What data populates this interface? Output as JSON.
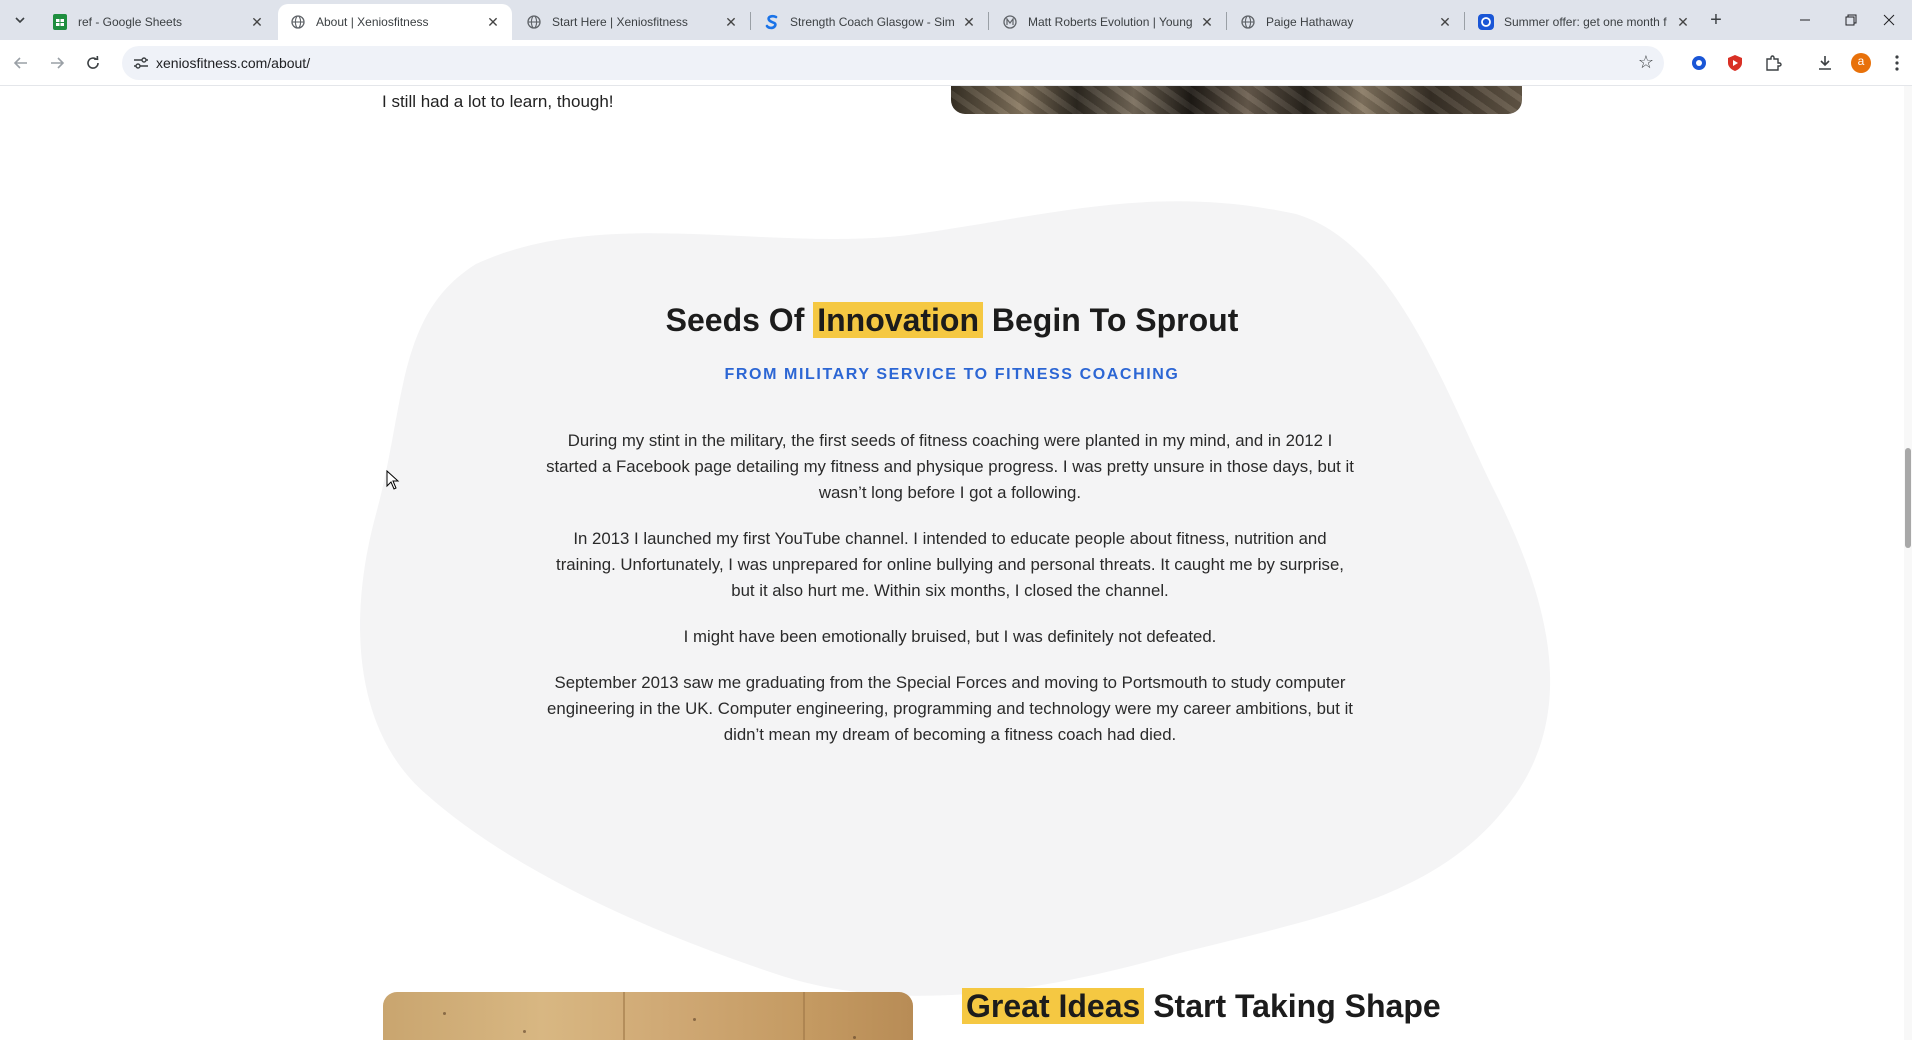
{
  "browser": {
    "tabs": [
      {
        "title": "ref - Google Sheets",
        "active": false,
        "favicon": "sheets-icon",
        "color": "#1e8e3e"
      },
      {
        "title": "About | Xeniosfitness",
        "active": true,
        "favicon": "globe-icon",
        "color": "#5f6368"
      },
      {
        "title": "Start Here | Xeniosfitness",
        "active": false,
        "favicon": "globe-icon",
        "color": "#5f6368"
      },
      {
        "title": "Strength Coach Glasgow - Simp",
        "active": false,
        "favicon": "s-brand-icon",
        "color": "#1a73e8"
      },
      {
        "title": "Matt Roberts Evolution | Young",
        "active": false,
        "favicon": "m-brand-icon",
        "color": "#5f6368"
      },
      {
        "title": "Paige Hathaway",
        "active": false,
        "favicon": "globe-icon",
        "color": "#5f6368"
      },
      {
        "title": "Summer offer: get one month f",
        "active": false,
        "favicon": "offer-icon",
        "color": "#1a56d6"
      }
    ],
    "url": "xeniosfitness.com/about/",
    "profile_initial": "a",
    "accent": "#e8710a"
  },
  "page": {
    "top_line": "I still had a lot to learn, though!",
    "section": {
      "title_before": "Seeds Of",
      "title_highlight": "Innovation",
      "title_after": "Begin To Sprout",
      "subtitle": "FROM MILITARY SERVICE TO FITNESS COACHING",
      "paragraphs": [
        "During my stint in the military, the first seeds of fitness coaching were planted in my mind, and in 2012 I started a Facebook page detailing my fitness and physique progress. I was pretty unsure in those days, but it wasn’t long before I got a following.",
        "In 2013 I launched my first YouTube channel. I intended to educate people about fitness, nutrition and training. Unfortunately, I was unprepared for online bullying and personal threats. It caught me by surprise, but it also hurt me. Within six months, I closed the channel.",
        "I might have been emotionally bruised, but I was definitely not defeated.",
        "September 2013 saw me graduating from the Special Forces and moving to Portsmouth to study computer engineering in the UK. Computer engineering, programming and technology were my career ambitions, but it didn’t mean my dream of becoming a fitness coach had died."
      ]
    },
    "next_section": {
      "title_highlight": "Great Ideas",
      "title_after": "Start Taking Shape"
    },
    "colors": {
      "highlight": "#f5c842",
      "subtitle": "#2c66d4",
      "blob": "#f4f4f5"
    }
  }
}
